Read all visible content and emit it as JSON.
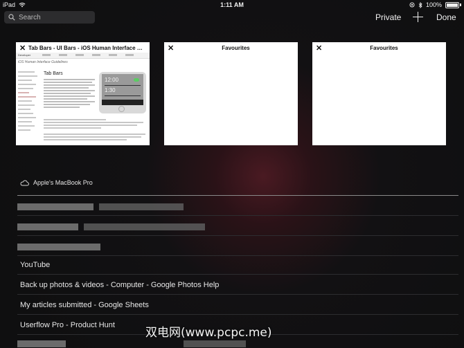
{
  "status_bar": {
    "device": "iPad",
    "time": "1:11 AM",
    "battery": "100%"
  },
  "toolbar": {
    "search_placeholder": "Search",
    "private_label": "Private",
    "done_label": "Done"
  },
  "tabs": [
    {
      "title": "Tab Bars - UI Bars - iOS Human Interface Guid...",
      "brand": "Developer",
      "subtitle": "iOS Human Interface Guidelines",
      "heading": "Tab Bars",
      "times": [
        "12:00",
        "1:30"
      ]
    },
    {
      "title": "Favourites"
    },
    {
      "title": "Favourites"
    }
  ],
  "cloud_tabs": {
    "device_name": "Apple's MacBook Pro",
    "items": [
      {
        "label": ""
      },
      {
        "label": ""
      },
      {
        "label": ""
      },
      {
        "label": "YouTube"
      },
      {
        "label": "Back up photos & videos - Computer - Google Photos Help"
      },
      {
        "label": "My articles submitted - Google Sheets"
      },
      {
        "label": "Userflow Pro - Product Hunt"
      },
      {
        "label": ""
      }
    ]
  },
  "watermark": "双电网(www.pcpc.me)",
  "colors": {
    "background": "#0f0f10",
    "glow": "#4a1a22",
    "text": "#e8e8e8",
    "toggle_on": "#5bcb63"
  }
}
